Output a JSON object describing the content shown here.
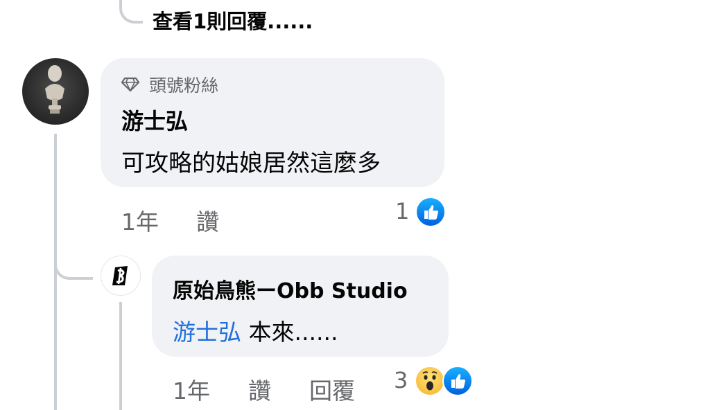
{
  "thread": {
    "view_replies_label": "查看1則回覆......"
  },
  "comment": {
    "badge_label": "頭號粉絲",
    "author": "游士弘",
    "text": "可攻略的姑娘居然這麼多",
    "time": "1年",
    "like_label": "讚",
    "reaction_count": "1",
    "reactions": [
      "like-icon"
    ]
  },
  "reply": {
    "author": "原始鳥熊ーObb Studio",
    "mention": "游士弘",
    "text": "本來......",
    "time": "1年",
    "like_label": "讚",
    "reply_label": "回覆",
    "reaction_count": "3",
    "reactions": [
      "wow-icon",
      "like-icon"
    ]
  },
  "colors": {
    "bubble": "#f0f2f5",
    "mention": "#216fdb",
    "meta_text": "#65676b",
    "like_blue": "#1877f2"
  }
}
